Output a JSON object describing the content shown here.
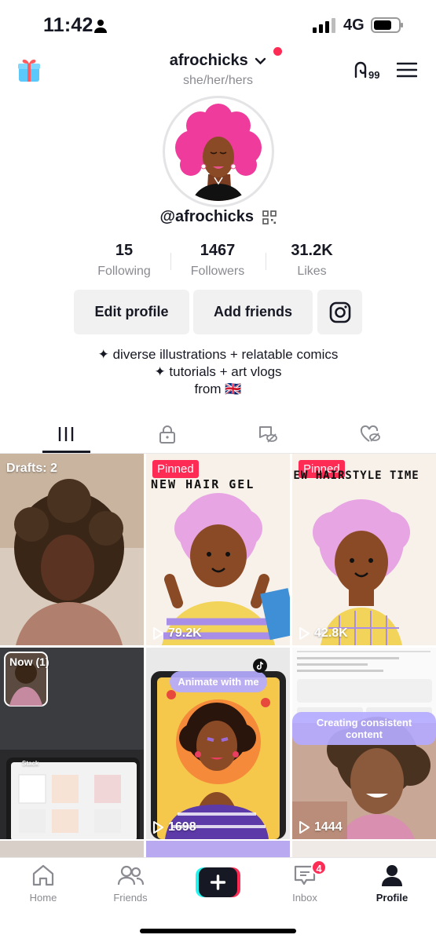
{
  "status_bar": {
    "time": "11:42",
    "network": "4G"
  },
  "header": {
    "username": "afrochicks",
    "pronouns": "she/her/hers",
    "handle": "@afrochicks"
  },
  "stats": [
    {
      "value": "15",
      "label": "Following"
    },
    {
      "value": "1467",
      "label": "Followers"
    },
    {
      "value": "31.2K",
      "label": "Likes"
    }
  ],
  "buttons": {
    "edit_profile": "Edit profile",
    "add_friends": "Add friends"
  },
  "bio": {
    "line1": "✦ diverse illustrations + relatable comics",
    "line2": "✦ tutorials + art vlogs",
    "line3": "from 🇬🇧"
  },
  "grid": {
    "drafts_label": "Drafts: 2",
    "now_label": "Now (1)",
    "pinned_label": "Pinned",
    "video2": {
      "text_top": "NEW HAIR GEL",
      "views": "79.2K"
    },
    "video3": {
      "text_top": "NEW HAIRSTYLE TIME",
      "views": "42.8K"
    },
    "video4": {
      "caption": "Stack"
    },
    "video5": {
      "bubble": "Animate with me",
      "views": "1698"
    },
    "video6": {
      "bubble": "Creating consistent content",
      "views": "1444"
    }
  },
  "nav": {
    "badge": "4",
    "items": [
      {
        "label": "Home",
        "icon": "home-icon"
      },
      {
        "label": "Friends",
        "icon": "friends-icon"
      },
      {
        "label": "",
        "icon": "plus-icon"
      },
      {
        "label": "Inbox",
        "icon": "inbox-icon"
      },
      {
        "label": "Profile",
        "icon": "profile-icon"
      }
    ]
  },
  "colors": {
    "accent": "#fe2c55",
    "cyan": "#25f4ee",
    "text": "#161823",
    "muted": "#8a8b91"
  }
}
